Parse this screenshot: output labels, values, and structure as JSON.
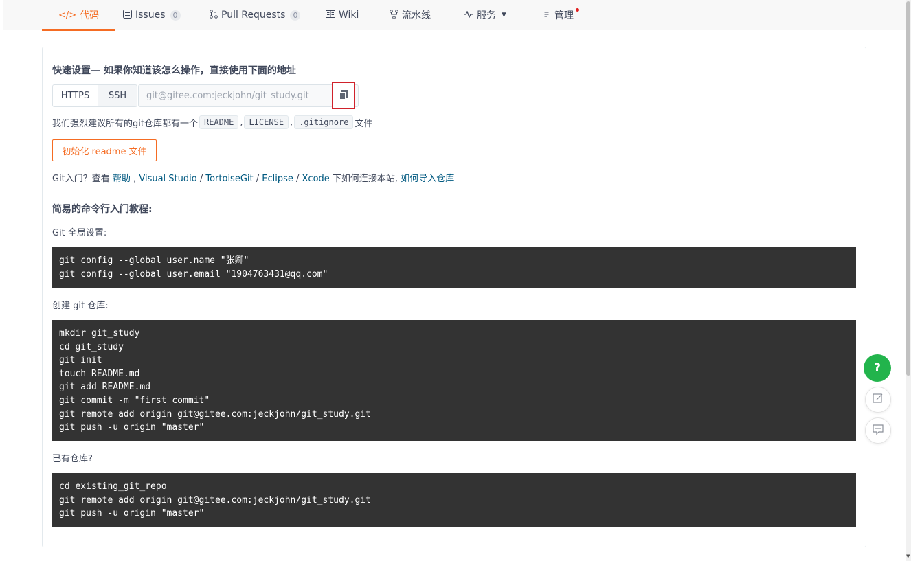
{
  "tabs": [
    {
      "label": "代码",
      "icon": "code-icon",
      "active": true
    },
    {
      "label": "Issues",
      "icon": "issues-icon",
      "count": "0"
    },
    {
      "label": "Pull Requests",
      "icon": "pull-request-icon",
      "count": "0"
    },
    {
      "label": "Wiki",
      "icon": "wiki-icon"
    },
    {
      "label": "流水线",
      "icon": "pipeline-icon"
    },
    {
      "label": "服务",
      "icon": "service-icon",
      "dropdown": true
    },
    {
      "label": "管理",
      "icon": "manage-icon",
      "notification_dot": true
    }
  ],
  "quick_setup": {
    "heading": "快速设置— 如果你知道该怎么操作，直接使用下面的地址",
    "https_label": "HTTPS",
    "ssh_label": "SSH",
    "url": "git@gitee.com:jeckjohn/git_study.git"
  },
  "recommend": {
    "prefix": "我们强烈建议所有的git仓库都有一个",
    "readme": "README",
    "sep1": ",",
    "license": "LICENSE",
    "sep2": ",",
    "gitignore": ".gitignore",
    "suffix": "文件"
  },
  "init_button": "初始化 readme 文件",
  "git_intro": {
    "prefix": "Git入门？查看 ",
    "help": "帮助",
    "sep0": " , ",
    "visual_studio": "Visual Studio",
    "sep1": " / ",
    "tortoisegit": "TortoiseGit",
    "sep2": " / ",
    "eclipse": "Eclipse",
    "sep3": " / ",
    "xcode": "Xcode",
    "middle": " 下如何连接本站, ",
    "import": "如何导入仓库"
  },
  "tutorial": {
    "heading": "简易的命令行入门教程:",
    "global_label": "Git 全局设置:",
    "global_code": "git config --global user.name \"张卿\"\ngit config --global user.email \"1904763431@qq.com\"",
    "create_label": "创建 git 仓库:",
    "create_code": "mkdir git_study\ncd git_study\ngit init\ntouch README.md\ngit add README.md\ngit commit -m \"first commit\"\ngit remote add origin git@gitee.com:jeckjohn/git_study.git\ngit push -u origin \"master\"",
    "existing_label": "已有仓库?",
    "existing_code": "cd existing_git_repo\ngit remote add origin git@gitee.com:jeckjohn/git_study.git\ngit push -u origin \"master\""
  },
  "floating": {
    "help_label": "?"
  },
  "colors": {
    "accent": "#f56c23",
    "link": "#005980",
    "code_bg": "#333333",
    "help_green": "#22b44c"
  }
}
